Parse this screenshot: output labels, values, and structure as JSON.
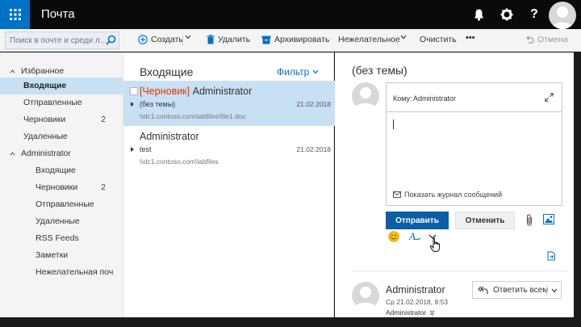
{
  "app": {
    "title": "Почта"
  },
  "topbar": {
    "icons": [
      "waffle-icon",
      "bell-icon",
      "gear-icon",
      "help-icon",
      "avatar"
    ],
    "help_glyph": "?"
  },
  "search": {
    "placeholder": "Поиск в почте и среди л..."
  },
  "commands": {
    "create": "Создать",
    "delete": "Удалить",
    "archive": "Архивировать",
    "junk": "Нежелательное",
    "sweep": "Очистить",
    "more": "•••",
    "undo": "Отмена"
  },
  "nav": {
    "favorites_label": "Избранное",
    "favorites": [
      {
        "label": "Входящие",
        "count": "",
        "selected": true
      },
      {
        "label": "Отправленные",
        "count": ""
      },
      {
        "label": "Черновики",
        "count": "2"
      },
      {
        "label": "Удаленные",
        "count": ""
      }
    ],
    "account_label": "Administrator",
    "folders": [
      {
        "label": "Входящие",
        "count": ""
      },
      {
        "label": "Черновики",
        "count": "2"
      },
      {
        "label": "Отправленные",
        "count": ""
      },
      {
        "label": "Удаленные",
        "count": ""
      },
      {
        "label": "RSS Feeds",
        "count": ""
      },
      {
        "label": "Заметки",
        "count": ""
      },
      {
        "label": "Нежелательная поч",
        "count": ""
      }
    ]
  },
  "list": {
    "title": "Входящие",
    "filter": "Фильтр",
    "messages": [
      {
        "draft_tag": "[Черновик]",
        "from": " Administrator",
        "subject": "(без темы)",
        "date": "21.02.2018",
        "path": "\\\\dc1.contoso.com\\labfiles\\file1.doc",
        "selected": true
      },
      {
        "draft_tag": "",
        "from": "Administrator",
        "subject": "test",
        "date": "21.02.2018",
        "path": "\\\\dc1.contoso.com\\labfiles",
        "selected": false
      }
    ]
  },
  "reading": {
    "title": "(без темы)",
    "to_label": "Кому:",
    "to_value": "Administrator",
    "show_log": "Показать журнал сообщений",
    "send": "Отправить",
    "cancel": "Отменить",
    "sender": "Administrator",
    "sent_time": "Ср 21.02.2018, 8:53",
    "sent_to": "Administrator",
    "reply_all": "Ответить всем"
  },
  "colors": {
    "accent": "#0072c6",
    "selected_bg": "#c8e0f4",
    "draft": "#d83b01",
    "send_button": "#0c5fa6"
  }
}
